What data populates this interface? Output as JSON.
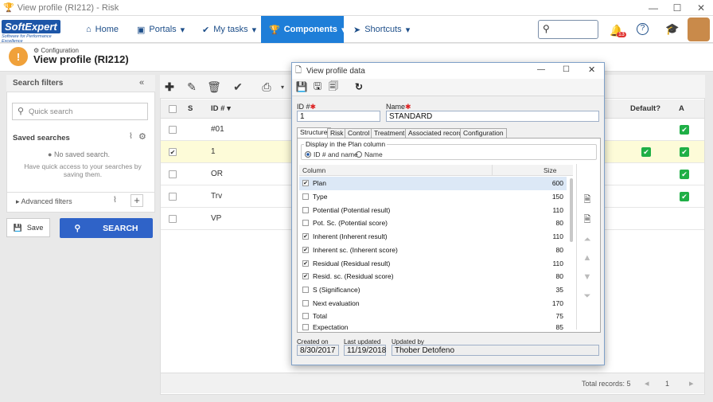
{
  "window": {
    "title": "View profile (RI212) - Risk"
  },
  "nav": {
    "home": "Home",
    "portals": "Portals",
    "mytasks": "My tasks",
    "components": "Components",
    "shortcuts": "Shortcuts",
    "badge": "13"
  },
  "logo": {
    "name": "SoftExpert",
    "tagline": "Software for Performance Excellence"
  },
  "page": {
    "breadcrumb": "Configuration",
    "title": "View profile (RI212)"
  },
  "filters": {
    "title": "Search filters",
    "quick_placeholder": "Quick search",
    "saved_title": "Saved searches",
    "no_saved": "No saved search.",
    "hint": "Have quick access to your searches by saving them.",
    "advanced": "Advanced filters",
    "save": "Save",
    "search": "SEARCH"
  },
  "grid": {
    "headers": {
      "s": "S",
      "id": "ID #",
      "default": "Default?",
      "a": "A"
    },
    "rows": [
      {
        "id": "#01",
        "sel": false,
        "def": false,
        "a": true
      },
      {
        "id": "1",
        "sel": true,
        "def": true,
        "a": true
      },
      {
        "id": "OR",
        "sel": false,
        "def": false,
        "a": true
      },
      {
        "id": "Trv",
        "sel": false,
        "def": false,
        "a": true
      },
      {
        "id": "VP",
        "sel": false,
        "def": false,
        "a": false
      }
    ],
    "total": "Total records: 5",
    "page": "1"
  },
  "dialog": {
    "title": "View profile data",
    "id_label": "ID #",
    "id_value": "1",
    "name_label": "Name",
    "name_value": "STANDARD",
    "tabs": [
      "Structure",
      "Risk",
      "Control",
      "Treatment",
      "Associated record",
      "Configuration"
    ],
    "display_label": "Display in the Plan column",
    "opt1": "ID # and name",
    "opt2": "Name",
    "col_header": "Column",
    "size_header": "Size",
    "columns": [
      {
        "name": "Plan",
        "size": "600",
        "chk": true
      },
      {
        "name": "Type",
        "size": "150",
        "chk": false
      },
      {
        "name": "Potential (Potential result)",
        "size": "110",
        "chk": false
      },
      {
        "name": "Pot. Sc. (Potential score)",
        "size": "80",
        "chk": false
      },
      {
        "name": "Inherent (Inherent result)",
        "size": "110",
        "chk": true
      },
      {
        "name": "Inherent sc. (Inherent score)",
        "size": "80",
        "chk": true
      },
      {
        "name": "Residual (Residual result)",
        "size": "110",
        "chk": true
      },
      {
        "name": "Resid. sc. (Residual score)",
        "size": "80",
        "chk": true
      },
      {
        "name": "S (Significance)",
        "size": "35",
        "chk": false
      },
      {
        "name": "Next evaluation",
        "size": "170",
        "chk": false
      },
      {
        "name": "Total",
        "size": "75",
        "chk": false
      },
      {
        "name": "Expectation",
        "size": "85",
        "chk": false
      }
    ],
    "created_label": "Created on",
    "created": "8/30/2017",
    "updated_label": "Last updated",
    "updated": "11/19/2018",
    "by_label": "Updated by",
    "by": "Thober Detofeno"
  }
}
